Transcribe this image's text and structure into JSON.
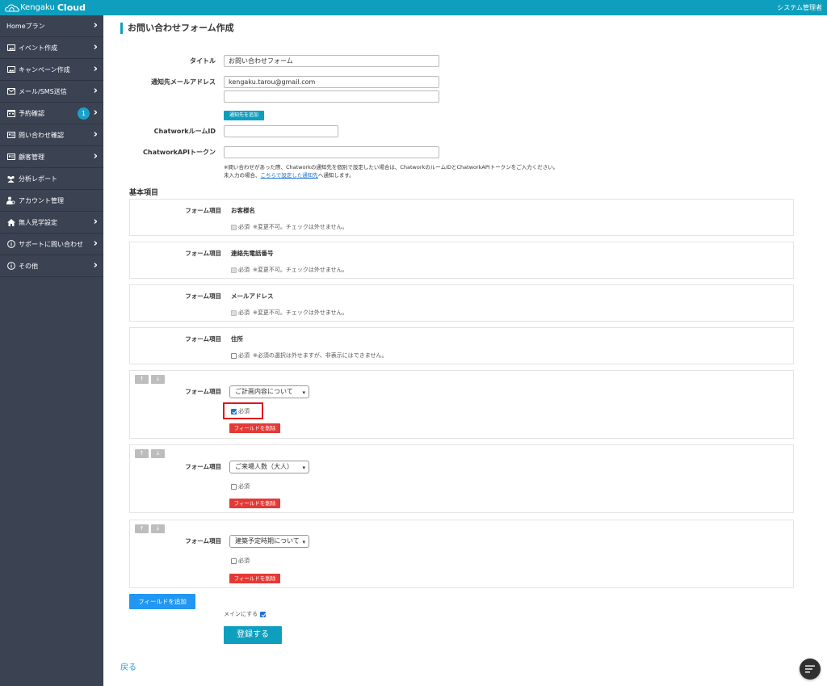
{
  "header": {
    "logo_text1": "Kengaku",
    "logo_text2": "Cloud",
    "user_name": "システム管理者"
  },
  "sidebar": {
    "items": [
      {
        "label": "Homeプラン",
        "icon": "none",
        "chevron": true
      },
      {
        "label": "イベント作成",
        "icon": "image-icon",
        "chevron": true
      },
      {
        "label": "キャンペーン作成",
        "icon": "image-icon",
        "chevron": true
      },
      {
        "label": "メール/SMS送信",
        "icon": "envelope-icon",
        "chevron": true
      },
      {
        "label": "予約確認",
        "icon": "calendar-icon",
        "chevron": true,
        "badge": "1"
      },
      {
        "label": "問い合わせ確認",
        "icon": "idcard-icon",
        "chevron": true
      },
      {
        "label": "顧客管理",
        "icon": "idcard-icon",
        "chevron": true
      },
      {
        "label": "分析レポート",
        "icon": "users-icon",
        "chevron": false
      },
      {
        "label": "アカウント管理",
        "icon": "user-gear-icon",
        "chevron": false
      },
      {
        "label": "無人見学設定",
        "icon": "home-icon",
        "chevron": true
      },
      {
        "label": "サポートに問い合わせ",
        "icon": "info-icon",
        "chevron": true
      },
      {
        "label": "その他",
        "icon": "info-icon",
        "chevron": true
      }
    ]
  },
  "page": {
    "title": "お問い合わせフォーム作成"
  },
  "form": {
    "title_label": "タイトル",
    "title_value": "お問い合わせフォーム",
    "email_label": "通知先メールアドレス",
    "email_value": "kengaku.tarou@gmail.com",
    "email_value2": "",
    "add_notify_btn": "通知先を追加",
    "chatwork_room_label": "ChatworkルームID",
    "chatwork_room_value": "",
    "chatwork_token_label": "ChatworkAPIトークン",
    "chatwork_token_value": "",
    "note_line1": "※問い合わせがあった際、Chatworkの通知先を個別で設定したい場合は、ChatworkのルームIDとChatworkAPIトークンをご入力ください。",
    "note_line2_pre": "未入力の場合、",
    "note_line2_link": "こちらで設定した通知先",
    "note_line2_post": "へ通知します。"
  },
  "basic": {
    "section_title": "基本項目",
    "field_label": "フォーム項目",
    "required_label": "必須",
    "fixed_note": "※変更不可。チェックは外せません。",
    "address_note": "※必須の選択は外せますが、非表示にはできません。",
    "fields": [
      {
        "name": "お客様名"
      },
      {
        "name": "連絡先電話番号"
      },
      {
        "name": "メールアドレス"
      },
      {
        "name": "住所"
      }
    ]
  },
  "custom": {
    "up_arrow": "↑",
    "down_arrow": "↓",
    "delete_btn": "フィールドを削除",
    "fields": [
      {
        "selected": "ご計画内容について",
        "required": true
      },
      {
        "selected": "ご来場人数（大人）",
        "required": false
      },
      {
        "selected": "建築予定時期について",
        "required": false
      }
    ]
  },
  "footer": {
    "add_field_btn": "フィールドを追加",
    "main_label": "メインにする",
    "main_checked": true,
    "submit_btn": "登録する",
    "back_link": "戻る"
  }
}
